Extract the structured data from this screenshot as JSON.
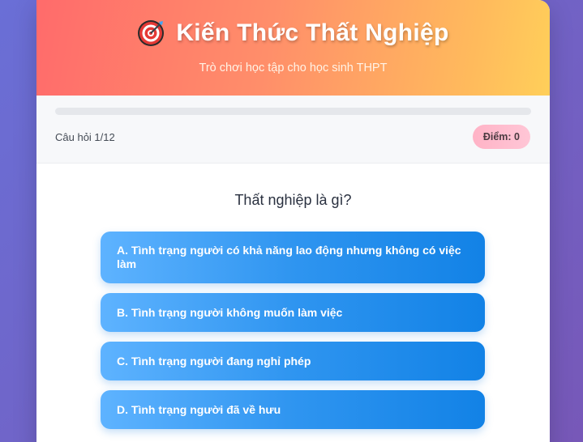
{
  "header": {
    "icon": "target-icon",
    "title": "Kiến Thức Thất Nghiệp",
    "subtitle": "Trò chơi học tập cho học sinh THPT"
  },
  "status": {
    "progress_fraction": 0,
    "question_counter": "Câu hỏi 1/12",
    "score_label": "Điểm: 0"
  },
  "quiz": {
    "question": "Thất nghiệp là gì?",
    "options": [
      {
        "label": "A. Tình trạng người có khả năng lao động nhưng không có việc làm"
      },
      {
        "label": "B. Tình trạng người không muốn làm việc"
      },
      {
        "label": "C. Tình trạng người đang nghỉ phép"
      },
      {
        "label": "D. Tình trạng người đã về hưu"
      }
    ]
  },
  "colors": {
    "header_start": "#ff6b6b",
    "header_end": "#ffcf5a",
    "option_start": "#5eb3ff",
    "option_end": "#1282e6",
    "score_badge": "#ffb3c6",
    "background": "#6a6fd6"
  }
}
